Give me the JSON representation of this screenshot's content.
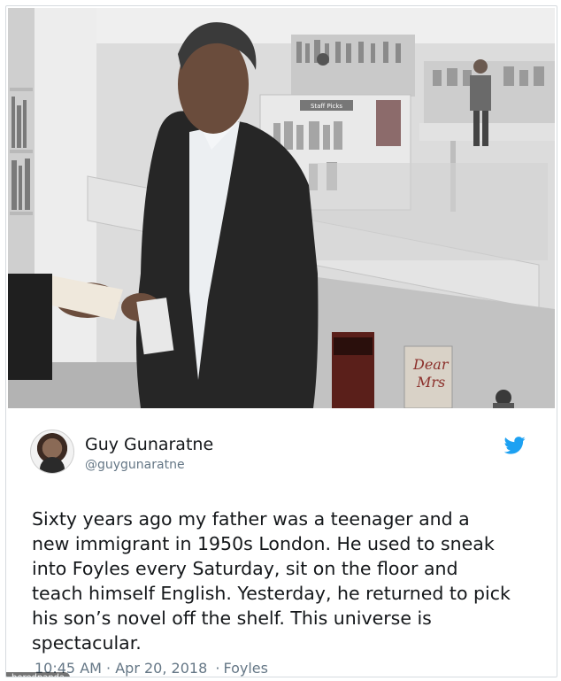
{
  "photo": {
    "books": {
      "spine_text_1": "Dear",
      "spine_text_2": "Mrs"
    },
    "shelf_sign": "Staff Picks"
  },
  "tweet": {
    "author_name": "Guy Gunaratne",
    "author_handle": "@guygunaratne",
    "text": "Sixty years ago my father was a teenager and a\nnew immigrant in 1950s London. He used to sneak\ninto Foyles every Saturday, sit on the floor and\nteach himself English. Yesterday, he returned to pick\nhis son’s novel off the shelf. This universe is\nspectacular.",
    "time": "10:45 AM",
    "date": "Apr 20, 2018",
    "location": "Foyles",
    "separator": "·"
  },
  "watermark": "boredpanda",
  "colors": {
    "twitter_blue": "#1da1f2",
    "text": "#14171a",
    "muted": "#657786"
  },
  "icons": {
    "brand": "twitter-bird-icon",
    "avatar": "author-avatar"
  }
}
